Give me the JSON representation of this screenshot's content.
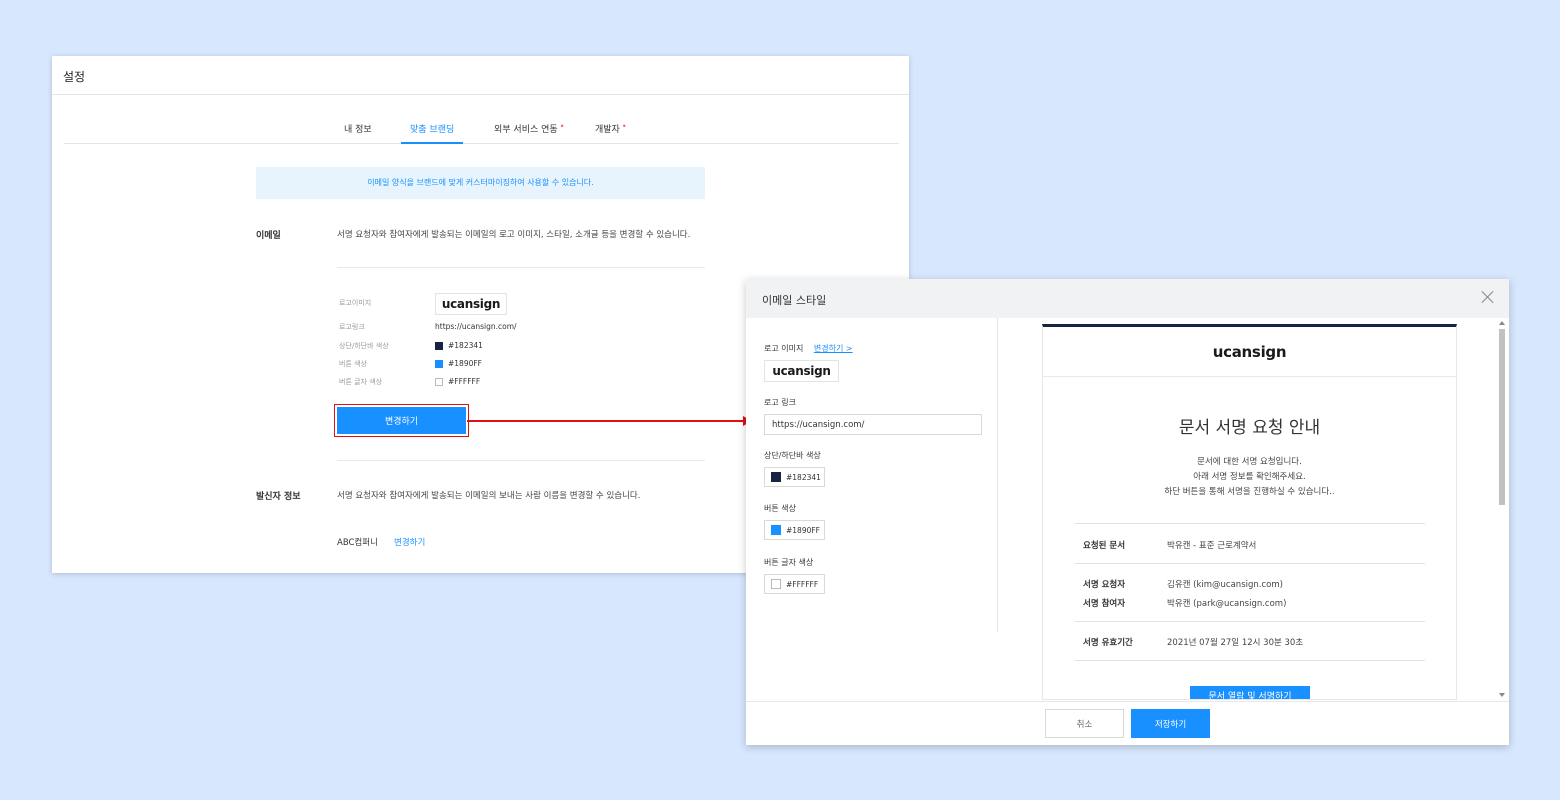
{
  "settings": {
    "title": "설정",
    "tabs": [
      {
        "label": "내 정보",
        "badge": ""
      },
      {
        "label": "맞춤 브랜딩",
        "badge": ""
      },
      {
        "label": "외부 서비스 연동",
        "badge": "•"
      },
      {
        "label": "개발자",
        "badge": "•"
      }
    ],
    "notice": "이메일 양식을 브랜드에 맞게 커스터마이징하여 사용할 수 있습니다.",
    "email": {
      "label": "이메일",
      "desc": "서명 요청자와 참여자에게 발송되는 이메일의 로고 이미지, 스타일, 소개글 등을 변경할 수 있습니다.",
      "fields": {
        "logo_image_label": "로고이미지",
        "logo_link_label": "로고링크",
        "logo_link_value": "https://ucansign.com/",
        "bar_color_label": "상단/하단바 색상",
        "bar_color_value": "#182341",
        "button_color_label": "버튼 색상",
        "button_color_value": "#1890FF",
        "button_text_color_label": "버튼 글자 색상",
        "button_text_color_value": "#FFFFFF"
      },
      "change_button": "변경하기"
    },
    "sender": {
      "label": "발신자 정보",
      "desc": "서명 요청자와 참여자에게 발송되는 이메일의 보내는 사람 이름을 변경할 수 있습니다.",
      "name": "ABC컴퍼니",
      "change_link": "변경하기"
    }
  },
  "logo_text": "ucansign",
  "modal": {
    "title": "이메일 스타일",
    "logo_image_label": "로고 이미지",
    "change_link": "변경하기 >",
    "logo_link_label": "로고 링크",
    "logo_link_value": "https://ucansign.com/",
    "bar_color_label": "상단/하단바 색상",
    "bar_color_value": "#182341",
    "button_color_label": "버튼 색상",
    "button_color_value": "#1890FF",
    "button_text_color_label": "버튼 글자 색상",
    "button_text_color_value": "#FFFFFF",
    "cancel": "취소",
    "save": "저장하기"
  },
  "preview": {
    "title": "문서 서명 요청 안내",
    "message": [
      "문서에 대한 서명 요청입니다.",
      "아래 서명 정보를 확인해주세요.",
      "하단 버튼을 통해 서명을 진행하실 수 있습니다.."
    ],
    "rows": {
      "doc_k": "요청된 문서",
      "doc_v": "박유캔 - 표준 근로계약서",
      "req_k": "서명 요청자",
      "req_v": "김유캔 (kim@ucansign.com)",
      "par_k": "서명 참여자",
      "par_v": "박유캔 (park@ucansign.com)",
      "exp_k": "서명 유효기간",
      "exp_v": "2021년 07월 27일 12시 30분 30초"
    },
    "button": "문서 열람 및 서명하기"
  },
  "colors": {
    "accent": "#1890ff",
    "bar": "#182341",
    "highlight": "#e01010"
  }
}
